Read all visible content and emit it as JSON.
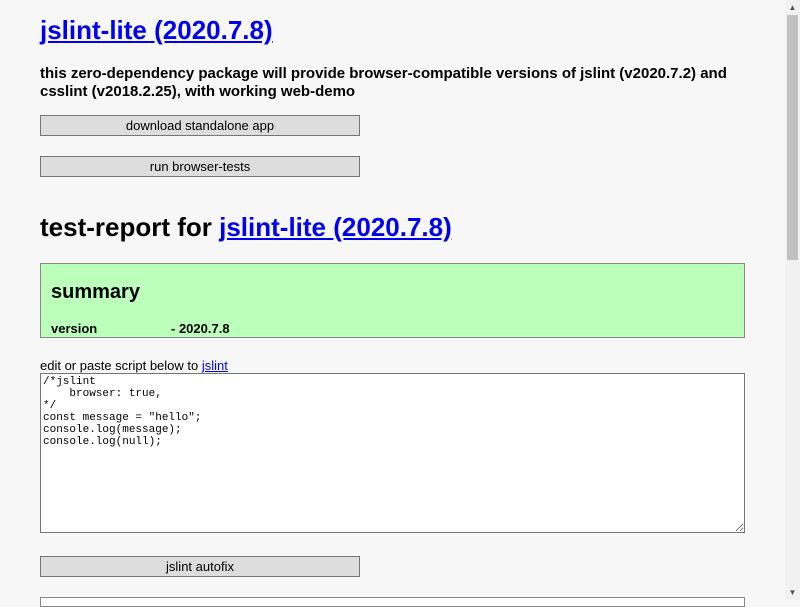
{
  "header": {
    "title_link": "jslint-lite (2020.7.8)",
    "description": "this zero-dependency package will provide browser-compatible versions of jslint (v2020.7.2) and csslint (v2018.2.25), with working web-demo"
  },
  "buttons": {
    "download": "download standalone app",
    "tests": "run browser-tests",
    "autofix": "jslint autofix"
  },
  "report": {
    "heading_prefix": "test-report for ",
    "heading_link": "jslint-lite (2020.7.8)",
    "summary": {
      "title": "summary",
      "rows": [
        {
          "key": "version",
          "value": "- 2020.7.8"
        }
      ]
    }
  },
  "editor": {
    "label_prefix": "edit or paste script below to ",
    "label_link": "jslint",
    "content": "/*jslint\n    browser: true,\n*/\nconst message = \"hello\";\nconsole.log(message);\nconsole.log(null);"
  },
  "colors": {
    "summary_bg": "#bbffbb",
    "link": "#0000ee"
  }
}
